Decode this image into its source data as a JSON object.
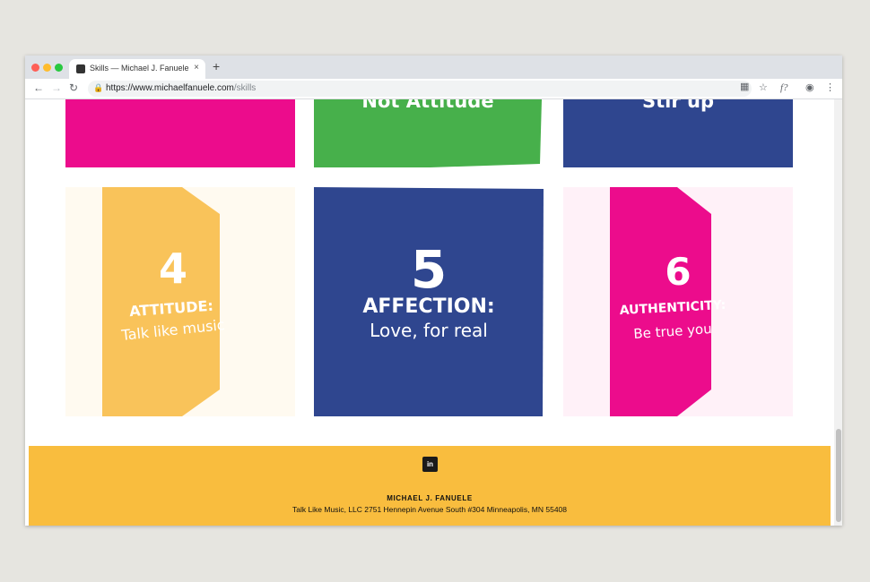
{
  "browser": {
    "tab_title": "Skills — Michael J. Fanuele",
    "tab_close": "×",
    "new_tab": "+",
    "url_host": "https://www.michaelfanuele.com",
    "url_path": "/skills",
    "lock_icon": "lock-icon",
    "extension_label": "f?"
  },
  "cards_row1": [
    {
      "label": "Not Attitude",
      "color": "#47b04b"
    },
    {
      "label": "Stir up",
      "color": "#2f468f"
    },
    {
      "label": "",
      "color": "#ec0c8c"
    }
  ],
  "cards_row2": [
    {
      "number": "4",
      "title": "ATTITUDE:",
      "subtitle": "Talk like music",
      "color": "#f9c35a",
      "bg": "#fffaf0"
    },
    {
      "number": "5",
      "title": "AFFECTION:",
      "subtitle": "Love, for real",
      "color": "#2f468f",
      "bg": "#ffffff"
    },
    {
      "number": "6",
      "title": "AUTHENTICITY:",
      "subtitle": "Be true you",
      "color": "#ec0c8c",
      "bg": "#fff1f8"
    }
  ],
  "footer": {
    "social_icon": "linkedin-icon",
    "social_label": "in",
    "name": "MICHAEL J. FANUELE",
    "address": "Talk Like Music, LLC 2751 Hennepin Avenue South #304 Minneapolis, MN 55408",
    "color": "#f9bd3e"
  }
}
